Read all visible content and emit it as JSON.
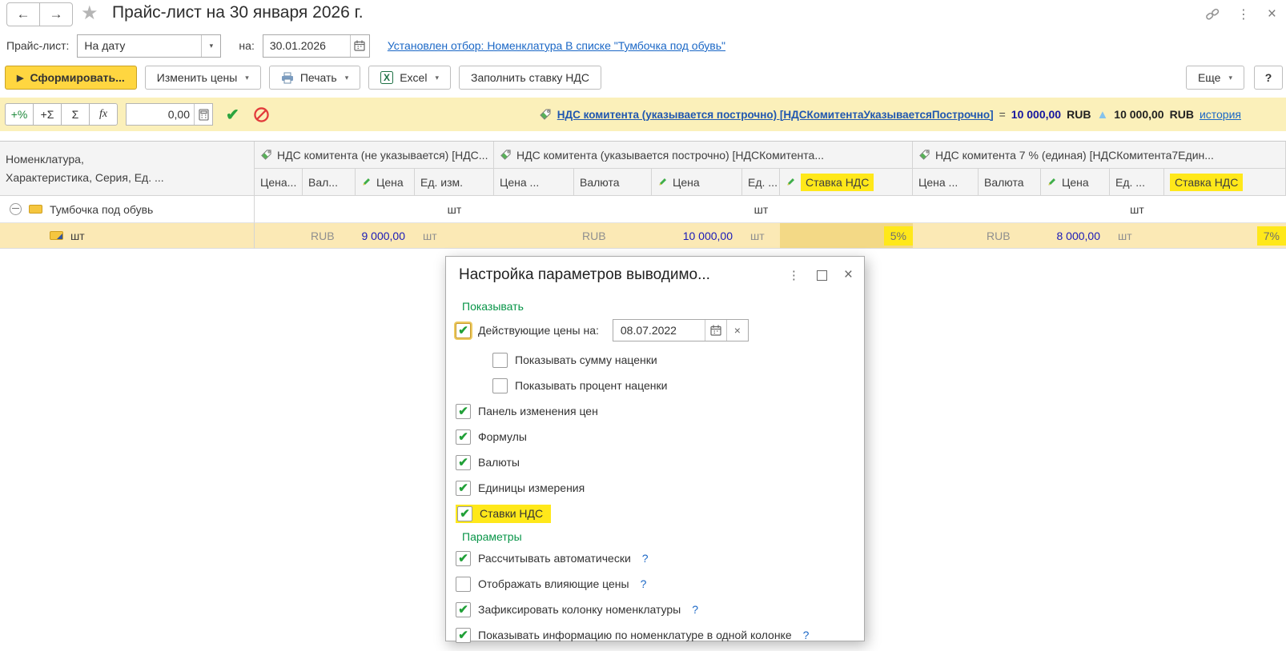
{
  "icons": {
    "back": "←",
    "forward": "→",
    "star": "★",
    "menu_dots": "⋮",
    "window_close": "×",
    "dropdown": "▾",
    "play": "▶",
    "apply_check": "✔",
    "delta_up": "▲",
    "dialog_menu": "⋮",
    "dialog_close": "×",
    "clear": "×",
    "help": "?"
  },
  "page_title": "Прайс-лист на 30 января 2026 г.",
  "filter_row": {
    "label": "Прайс-лист:",
    "mode": "На дату",
    "on_label": "на:",
    "date": "30.01.2026",
    "filter_link": "Установлен отбор: Номенклатура В списке \"Тумбочка под обувь\""
  },
  "toolbar": {
    "generate": "Сформировать...",
    "change_prices": "Изменить цены",
    "print": "Печать",
    "excel": "Excel",
    "fill_vat": "Заполнить ставку НДС",
    "more": "Еще",
    "help": "?"
  },
  "formula_bar": {
    "btn_percent": "+%",
    "btn_add_sum": "+Σ",
    "btn_sum": "Σ",
    "btn_fx": "fx",
    "value": "0,00",
    "link": "НДС комитента (указывается построчно) [НДСКомитентаУказываетсяПострочно]",
    "equals": "=",
    "amount": "10 000,00",
    "currency": "RUB",
    "delta_amount": "10 000,00",
    "delta_currency": "RUB",
    "history_link": "история"
  },
  "table": {
    "nomenclature_line1": "Номенклатура,",
    "nomenclature_line2": "Характеристика, Серия, Ед. ...",
    "groups": [
      {
        "title": "НДС комитента (не указывается) [НДС...",
        "col_price_type": "Цена...",
        "col_currency": "Вал...",
        "col_price": "Цена",
        "col_unit": "Ед. изм."
      },
      {
        "title": "НДС комитента (указывается построчно) [НДСКомитента...",
        "col_price_type": "Цена ...",
        "col_currency": "Валюта",
        "col_price": "Цена",
        "col_unit": "Ед. ...",
        "col_vat": "Ставка НДС"
      },
      {
        "title": "НДС комитента 7 % (единая) [НДСКомитента7Един...",
        "col_price_type": "Цена ...",
        "col_currency": "Валюта",
        "col_price": "Цена",
        "col_unit": "Ед. ...",
        "col_vat": "Ставка НДС"
      }
    ],
    "group_row": {
      "name": "Тумбочка под обувь",
      "unit1": "шт",
      "unit2": "шт",
      "unit3": "шт"
    },
    "detail_row": {
      "name": "шт",
      "g1": {
        "currency": "RUB",
        "price": "9 000,00",
        "unit": "шт"
      },
      "g2": {
        "currency": "RUB",
        "price": "10 000,00",
        "unit": "шт",
        "vat": "5%"
      },
      "g3": {
        "currency": "RUB",
        "price": "8 000,00",
        "unit": "шт",
        "vat": "7%"
      }
    }
  },
  "dialog": {
    "title": "Настройка параметров выводимо...",
    "sections": {
      "show": "Показывать",
      "params": "Параметры"
    },
    "date_row": {
      "label": "Действующие цены на:",
      "date": "08.07.2022",
      "checked": true
    },
    "show_items": [
      {
        "label": "Показывать сумму наценки",
        "checked": false
      },
      {
        "label": "Показывать процент наценки",
        "checked": false
      },
      {
        "label": "Панель изменения цен",
        "checked": true
      },
      {
        "label": "Формулы",
        "checked": true
      },
      {
        "label": "Валюты",
        "checked": true
      },
      {
        "label": "Единицы измерения",
        "checked": true
      },
      {
        "label": "Ставки НДС",
        "checked": true,
        "highlighted": true
      }
    ],
    "param_items": [
      {
        "label": "Рассчитывать автоматически",
        "help": "?",
        "checked": true
      },
      {
        "label": "Отображать влияющие цены",
        "help": "?",
        "checked": false
      },
      {
        "label": "Зафиксировать колонку номенклатуры",
        "help": "?",
        "checked": true
      },
      {
        "label": "Показывать информацию по номенклатуре в одной колонке",
        "help": "?",
        "checked": true
      }
    ]
  },
  "colors": {
    "accent_yellow": "#ffd640",
    "marker_highlight": "#ffe81a",
    "row_yellow": "#fbe9b5",
    "selected_cell": "#f3d986",
    "link_blue": "#1a67c6",
    "section_green": "#089548",
    "price_blue": "#1a1ab8"
  }
}
